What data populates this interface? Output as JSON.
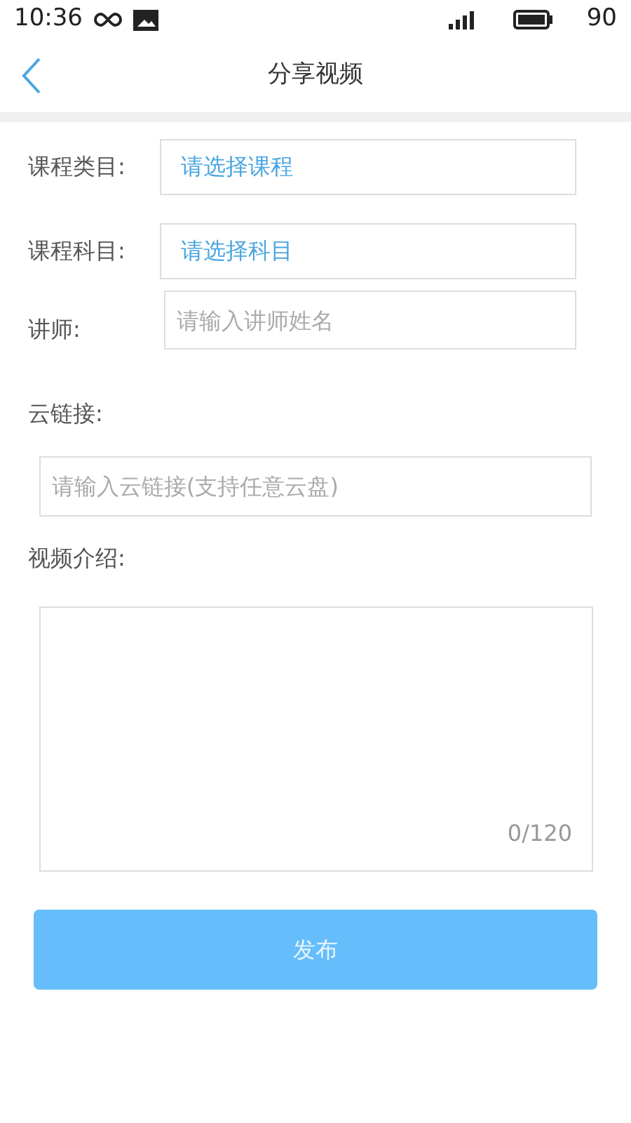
{
  "status_bar": {
    "time": "10:36",
    "battery": "90"
  },
  "header": {
    "title": "分享视频"
  },
  "rows": [
    {
      "label": "课程类目:",
      "kind": "select",
      "value": "请选择课程"
    },
    {
      "label": "课程科目:",
      "kind": "select",
      "value": "请选择科目"
    },
    {
      "label": "讲师:",
      "kind": "text",
      "placeholder": "请输入讲师姓名"
    }
  ],
  "link": {
    "label": "云链接:",
    "placeholder": "请输入云链接(支持任意云盘)"
  },
  "intro": {
    "label": "视频介绍:",
    "counter": "0/120"
  },
  "submit": {
    "label": "发布",
    "disabled": true
  }
}
